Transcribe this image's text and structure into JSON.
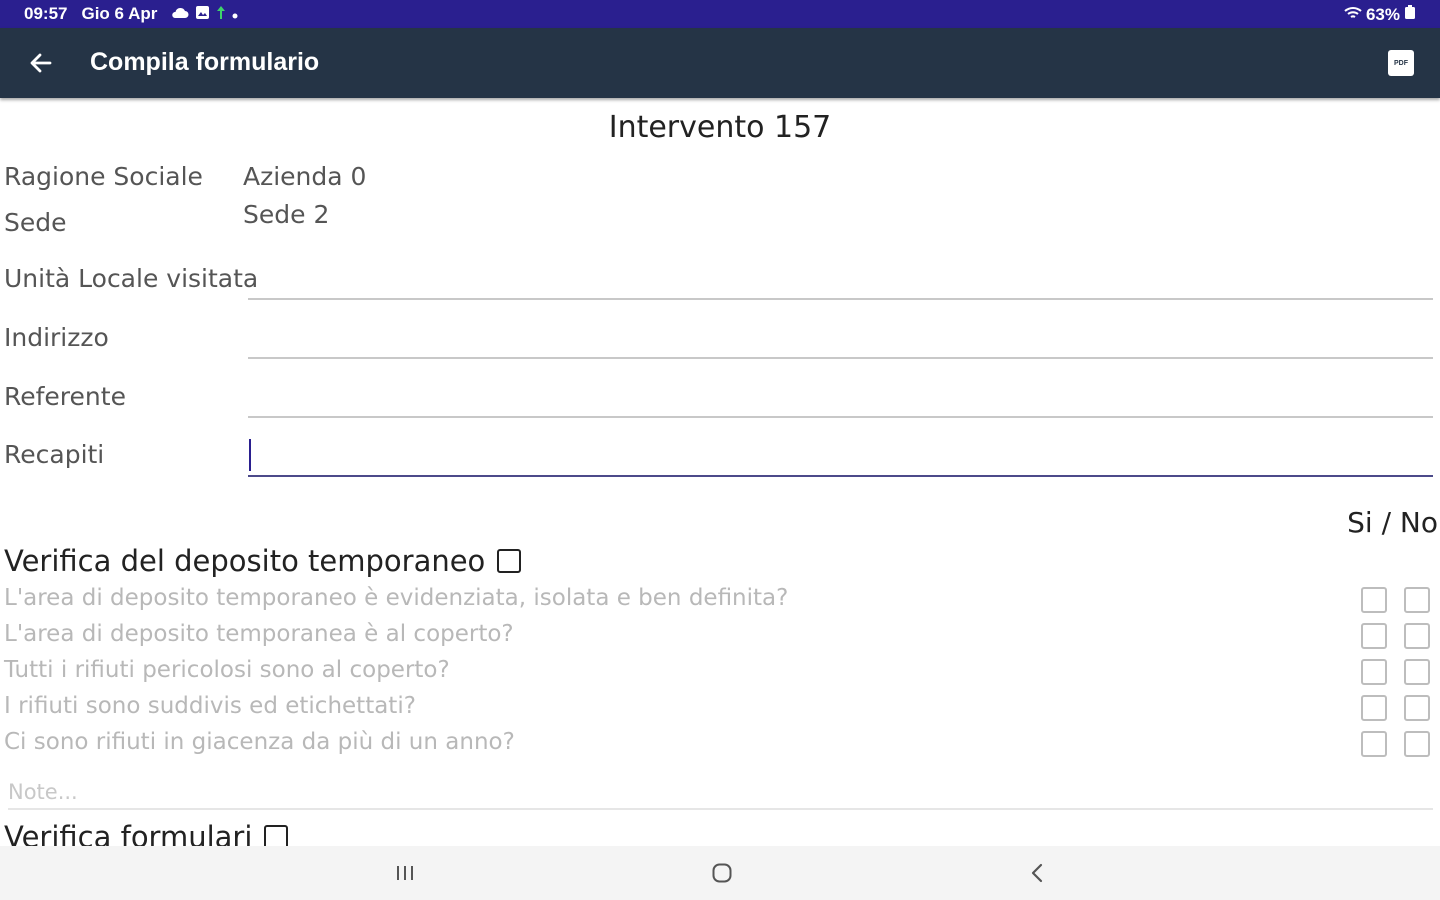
{
  "status_bar": {
    "time": "09:57",
    "date": "Gio 6 Apr",
    "battery": "63%",
    "icons": [
      "cloud-icon",
      "gallery-icon",
      "upload-icon",
      "dot-icon",
      "wifi-icon",
      "battery-icon"
    ]
  },
  "toolbar": {
    "title": "Compila formulario",
    "back_icon": "arrow-left-icon",
    "pdf_label": "PDF"
  },
  "form": {
    "title": "Intervento 157",
    "fields": [
      {
        "label": "Ragione Sociale",
        "value": "Azienda 0"
      },
      {
        "label": "Sede",
        "value": "Sede 2"
      }
    ],
    "inputs": [
      {
        "label": "Unità Locale visitata",
        "value": ""
      },
      {
        "label": "Indirizzo",
        "value": ""
      },
      {
        "label": "Referente",
        "value": ""
      },
      {
        "label": "Recapiti",
        "value": ""
      }
    ]
  },
  "checklist": {
    "header": "Si / No",
    "sections": [
      {
        "title": "Verifica del deposito temporaneo",
        "questions": [
          "L'area di deposito temporaneo è evidenziata, isolata e ben definita?",
          "L'area di deposito temporanea è al coperto?",
          "Tutti i rifiuti pericolosi sono al coperto?",
          "I rifiuti sono suddivis ed etichettati?",
          "Ci sono rifiuti in giacenza da più di un anno?"
        ],
        "note_placeholder": "Note..."
      },
      {
        "title": "Verifica formulari"
      }
    ]
  },
  "nav_bar": {
    "icons": [
      "recent-apps-icon",
      "home-icon",
      "back-icon"
    ]
  },
  "colors": {
    "status_bar": "#2a1f8f",
    "toolbar": "#253446",
    "focus": "#4c4a8a"
  }
}
